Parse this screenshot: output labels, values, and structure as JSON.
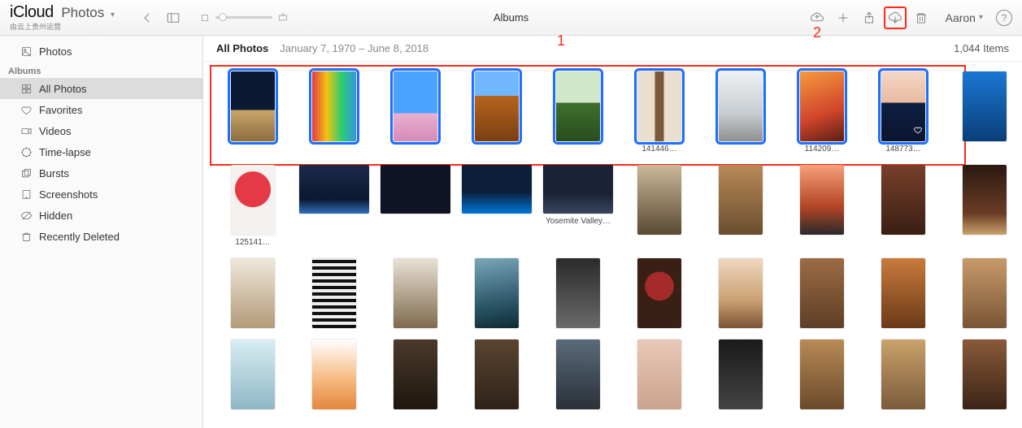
{
  "toolbar": {
    "brand": "iCloud",
    "section": "Photos",
    "brand_tagline": "由云上贵州运营",
    "center_title": "Albums",
    "user_name": "Aaron",
    "callout_1": "1",
    "callout_2": "2"
  },
  "sidebar": {
    "photos_label": "Photos",
    "albums_header": "Albums",
    "items": [
      {
        "label": "All Photos",
        "icon": "grid"
      },
      {
        "label": "Favorites",
        "icon": "heart"
      },
      {
        "label": "Videos",
        "icon": "video"
      },
      {
        "label": "Time-lapse",
        "icon": "timelapse"
      },
      {
        "label": "Bursts",
        "icon": "bursts"
      },
      {
        "label": "Screenshots",
        "icon": "screenshot"
      },
      {
        "label": "Hidden",
        "icon": "hidden"
      },
      {
        "label": "Recently Deleted",
        "icon": "trash"
      }
    ]
  },
  "content": {
    "title": "All Photos",
    "date_range": "January 7, 1970 – June 8, 2018",
    "count_label": "1,044 Items"
  },
  "photos": [
    {
      "sel": true,
      "cls": "g1"
    },
    {
      "sel": true,
      "cls": "g2"
    },
    {
      "sel": true,
      "cls": "g3"
    },
    {
      "sel": true,
      "cls": "g4"
    },
    {
      "sel": true,
      "cls": "g5"
    },
    {
      "sel": true,
      "cls": "g6",
      "caption": "141446…"
    },
    {
      "sel": true,
      "cls": "g7"
    },
    {
      "sel": true,
      "cls": "g8",
      "caption": "114209…"
    },
    {
      "sel": true,
      "cls": "g9",
      "caption": "148773…",
      "fav": true
    },
    {
      "sel": false,
      "cls": "g10"
    },
    {
      "sel": false,
      "cls": "g11",
      "caption": "125141…"
    },
    {
      "sel": false,
      "cls": "g12",
      "wide": true
    },
    {
      "sel": false,
      "cls": "g13",
      "wide": true
    },
    {
      "sel": false,
      "cls": "g14",
      "wide": true
    },
    {
      "sel": false,
      "cls": "g15",
      "wide": true,
      "caption": "Yosemite Valley…"
    },
    {
      "sel": false,
      "cls": "g16"
    },
    {
      "sel": false,
      "cls": "g17"
    },
    {
      "sel": false,
      "cls": "g18"
    },
    {
      "sel": false,
      "cls": "g19"
    },
    {
      "sel": false,
      "cls": "g20"
    },
    {
      "sel": false,
      "cls": "g21"
    },
    {
      "sel": false,
      "cls": "g22"
    },
    {
      "sel": false,
      "cls": "g23"
    },
    {
      "sel": false,
      "cls": "g24"
    },
    {
      "sel": false,
      "cls": "g25"
    },
    {
      "sel": false,
      "cls": "g26"
    },
    {
      "sel": false,
      "cls": "g27"
    },
    {
      "sel": false,
      "cls": "g28"
    },
    {
      "sel": false,
      "cls": "g29"
    },
    {
      "sel": false,
      "cls": "g30"
    },
    {
      "sel": false,
      "cls": "g31"
    },
    {
      "sel": false,
      "cls": "g32"
    },
    {
      "sel": false,
      "cls": "g33"
    },
    {
      "sel": false,
      "cls": "g34"
    },
    {
      "sel": false,
      "cls": "g35"
    },
    {
      "sel": false,
      "cls": "g36"
    },
    {
      "sel": false,
      "cls": "g37"
    },
    {
      "sel": false,
      "cls": "g38"
    },
    {
      "sel": false,
      "cls": "g39"
    },
    {
      "sel": false,
      "cls": "g40"
    }
  ]
}
